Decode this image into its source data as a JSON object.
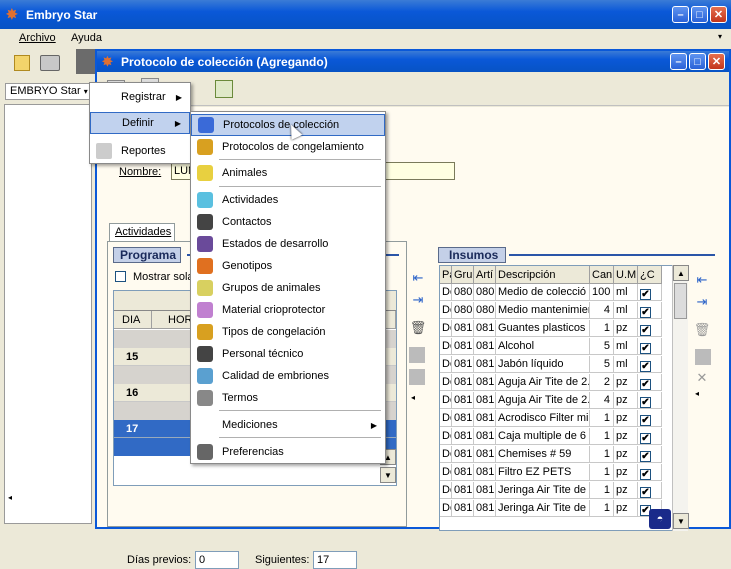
{
  "app": {
    "title": "Embryo Star"
  },
  "menubar": {
    "items": [
      "Archivo",
      "Ayuda"
    ]
  },
  "toolbar": {
    "dropdown_label": "EMBRYO Star"
  },
  "dialog": {
    "title": "Protocolo de colección (Agregando)"
  },
  "form": {
    "nombre_label": "Nombre:",
    "nombre_value": "LUN"
  },
  "tabs": {
    "actividades": "Actividades"
  },
  "programa": {
    "title": "Programa",
    "show_label": "Mostrar sola",
    "col_dia": "DIA",
    "col_hora": "HOR",
    "days": [
      "15",
      "16",
      "17"
    ],
    "dias_previos_label": "Días previos:",
    "dias_previos_value": "0",
    "siguientes_label": "Siguientes:",
    "siguientes_value": "17"
  },
  "insumos": {
    "title": "Insumos",
    "headers": [
      "Pa",
      "Gru",
      "Artí",
      "Descripción",
      "Can",
      "U.M",
      "¿C"
    ],
    "rows": [
      [
        "Do",
        "080",
        "080",
        "Medio de colecció",
        "100",
        "ml",
        "✔"
      ],
      [
        "Do",
        "080",
        "080",
        "Medio mantenimier",
        "4",
        "ml",
        "✔"
      ],
      [
        "Do",
        "081",
        "081",
        "Guantes plasticos |",
        "1",
        "pz",
        "✔"
      ],
      [
        "Do",
        "081",
        "081",
        "Alcohol",
        "5",
        "ml",
        "✔"
      ],
      [
        "Do",
        "081",
        "081",
        "Jabón líquido",
        "5",
        "ml",
        "✔"
      ],
      [
        "Do",
        "081",
        "081",
        "Aguja Air Tite de 2.",
        "2",
        "pz",
        "✔"
      ],
      [
        "Do",
        "081",
        "081",
        "Aguja Air Tite de 2.",
        "4",
        "pz",
        "✔"
      ],
      [
        "Do",
        "081",
        "081",
        "Acrodisco Filter mili",
        "1",
        "pz",
        "✔"
      ],
      [
        "Do",
        "081",
        "081",
        "Caja multiple de 6",
        "1",
        "pz",
        "✔"
      ],
      [
        "Do",
        "081",
        "081",
        "Chemises # 59",
        "1",
        "pz",
        "✔"
      ],
      [
        "Do",
        "081",
        "081",
        "Filtro EZ PETS",
        "1",
        "pz",
        "✔"
      ],
      [
        "Do",
        "081",
        "081",
        "Jeringa Air Tite de",
        "1",
        "pz",
        "✔"
      ],
      [
        "Do",
        "081",
        "081",
        "Jeringa Air Tite de",
        "1",
        "pz",
        "✔"
      ]
    ]
  },
  "menu1": {
    "items": [
      "Registrar",
      "Definir",
      "Reportes"
    ]
  },
  "menu2": {
    "items": [
      "Protocolos de colección",
      "Protocolos de congelamiento",
      "Animales",
      "Actividades",
      "Contactos",
      "Estados de desarrollo",
      "Genotipos",
      "Grupos de animales",
      "Material crioprotector",
      "Tipos de congelación",
      "Personal técnico",
      "Calidad de embriones",
      "Termos",
      "Mediciones",
      "Preferencias"
    ]
  }
}
